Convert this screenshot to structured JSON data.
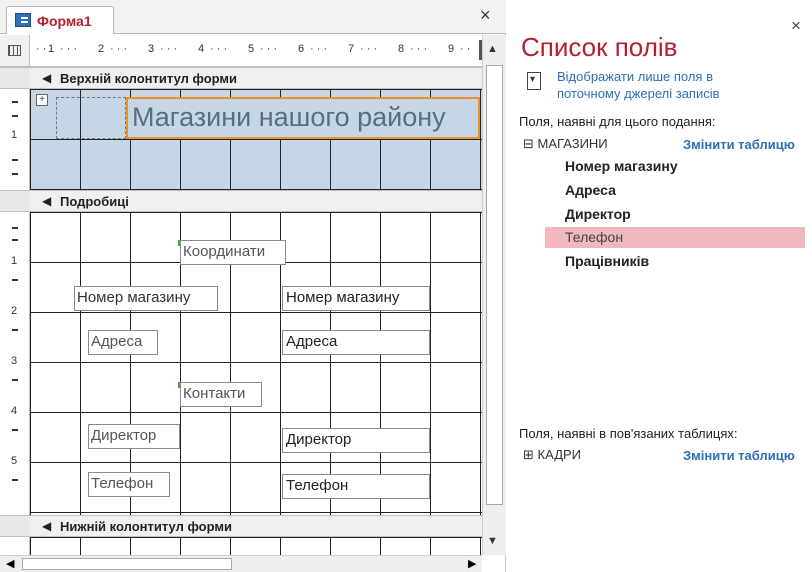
{
  "designer": {
    "tab_label": "Форма1",
    "close_glyph": "×",
    "ruler_numbers": [
      "1",
      "2",
      "3",
      "4",
      "5",
      "6",
      "7",
      "8",
      "9"
    ],
    "vruler_numbers": [
      "1",
      "2",
      "3",
      "4",
      "5"
    ],
    "sections": {
      "header": "Верхній колонтитул форми",
      "detail": "Подробиці",
      "footer": "Нижній колонтитул форми"
    },
    "header_label": "Магазини нашого району",
    "controls": {
      "label_coords": "Координати",
      "label_store": "Номер магазину",
      "field_store": "Номер магазину",
      "label_address": "Адреса",
      "field_address": "Адреса",
      "label_contacts": "Контакти",
      "label_director": "Директор",
      "field_director": "Директор",
      "label_phone": "Телефон",
      "field_phone": "Телефон"
    }
  },
  "field_list": {
    "title": "Список полів",
    "close_glyph": "×",
    "toggle_link": "Відображати лише поля в поточному джерелі записів",
    "available_label": "Поля, наявні для цього подання:",
    "table_name": "МАГАЗИНИ",
    "table_expand": "⊟",
    "edit_table": "Змінити таблицю",
    "fields": [
      "Номер магазину",
      "Адреса",
      "Директор",
      "Телефон",
      "Працівників"
    ],
    "selected_field": "Телефон",
    "related_label": "Поля, наявні в пов'язаних таблицях:",
    "related_table": "КАДРИ",
    "related_expand": "⊞",
    "related_edit": "Змінити таблицю"
  },
  "colors": {
    "accent": "#b3212e",
    "link": "#2e6fb7",
    "selection": "#f2b8c0",
    "header_band": "#c5d6e6",
    "selected_outline": "#f0902a"
  }
}
